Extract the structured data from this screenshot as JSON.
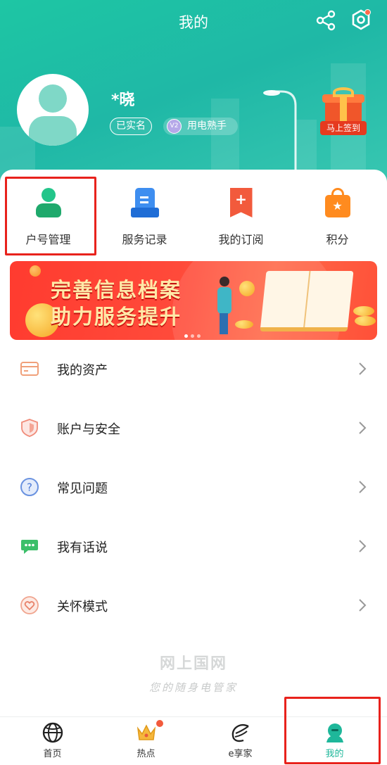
{
  "header": {
    "title": "我的",
    "share_icon": "share-icon",
    "settings_icon": "settings-icon",
    "background_color": "#1fbea6"
  },
  "profile": {
    "username": "*晓",
    "verified_label": "已实名",
    "level_badge": "V2",
    "level_label": "用电熟手",
    "checkin_label": "马上签到"
  },
  "quick_actions": [
    {
      "label": "户号管理",
      "icon": "account-number-icon",
      "color": "#1fa96c"
    },
    {
      "label": "服务记录",
      "icon": "service-records-icon",
      "color": "#3e8ef0"
    },
    {
      "label": "我的订阅",
      "icon": "subscription-icon",
      "color": "#f25a3c"
    },
    {
      "label": "积分",
      "icon": "points-bag-icon",
      "color": "#ff8b1f"
    }
  ],
  "banner": {
    "line1": "完善信息档案",
    "line2": "助力服务提升",
    "page_indicator": {
      "current": 1,
      "total": 3
    }
  },
  "menu": [
    {
      "label": "我的资产",
      "icon": "assets-card-icon"
    },
    {
      "label": "账户与安全",
      "icon": "shield-icon"
    },
    {
      "label": "常见问题",
      "icon": "question-icon"
    },
    {
      "label": "我有话说",
      "icon": "chat-bubble-icon"
    },
    {
      "label": "关怀模式",
      "icon": "care-heart-icon"
    }
  ],
  "watermark": {
    "brand": "网上国网",
    "slogan": "您的随身电管家"
  },
  "bottom_nav": [
    {
      "label": "首页",
      "icon": "home-globe-icon"
    },
    {
      "label": "热点",
      "icon": "crown-icon",
      "has_dot": true
    },
    {
      "label": "e享家",
      "icon": "e-home-icon"
    },
    {
      "label": "我的",
      "icon": "profile-icon",
      "active": true
    }
  ],
  "highlight_color": "#e8221c"
}
